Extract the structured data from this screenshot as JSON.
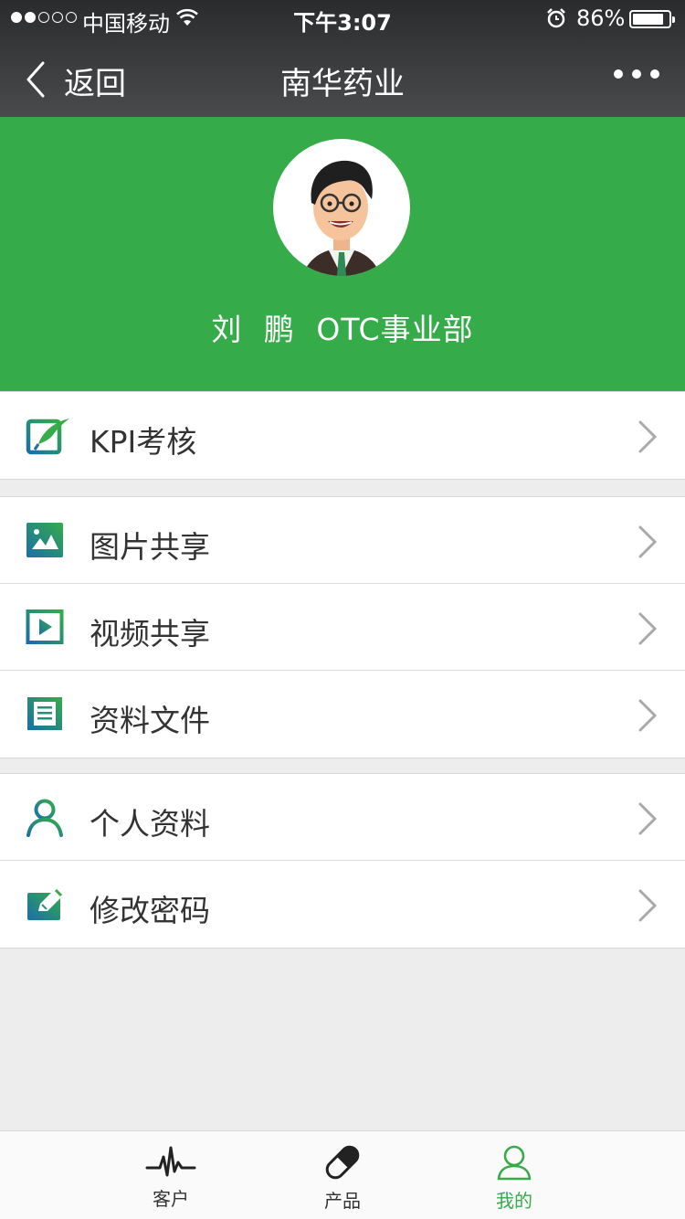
{
  "status_bar": {
    "carrier": "中国移动",
    "time": "下午3:07",
    "battery": "86%",
    "signal_bars_filled": 2,
    "signal_bars_total": 5,
    "battery_level": 0.86
  },
  "nav": {
    "back_label": "返回",
    "title": "南华药业"
  },
  "profile": {
    "name_line": "刘 鹏 OTC事业部"
  },
  "menu": {
    "group1": [
      {
        "label": "KPI考核",
        "icon": "kpi-edit-icon"
      }
    ],
    "group2": [
      {
        "label": "图片共享",
        "icon": "picture-icon"
      },
      {
        "label": "视频共享",
        "icon": "video-icon"
      },
      {
        "label": "资料文件",
        "icon": "document-icon"
      }
    ],
    "group3": [
      {
        "label": "个人资料",
        "icon": "person-icon"
      },
      {
        "label": "修改密码",
        "icon": "edit-password-icon"
      }
    ]
  },
  "tabbar": {
    "tabs": [
      {
        "label": "客户",
        "icon": "pulse-icon"
      },
      {
        "label": "产品",
        "icon": "pill-icon"
      },
      {
        "label": "我的",
        "icon": "user-icon",
        "active": true
      }
    ]
  },
  "colors": {
    "brand_green": "#35ab49",
    "icon_blue": "#1a6fa8",
    "nav_dark": "#2a2b2d",
    "background": "#ededed"
  }
}
